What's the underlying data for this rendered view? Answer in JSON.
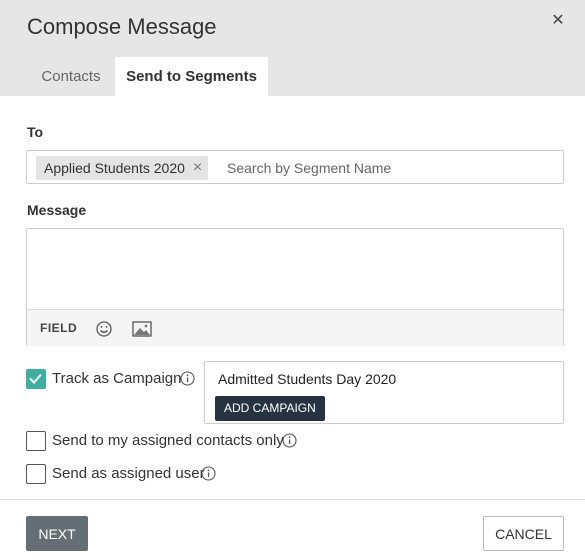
{
  "dialog": {
    "title": "Compose Message",
    "close_icon": "close-icon"
  },
  "tabs": [
    {
      "label": "Contacts",
      "active": false
    },
    {
      "label": "Send to Segments",
      "active": true
    }
  ],
  "to": {
    "label": "To",
    "selected_segments": [
      {
        "label": "Applied Students 2020",
        "remove_icon": "close-icon"
      }
    ],
    "placeholder": "Search by Segment Name",
    "value": ""
  },
  "message": {
    "label": "Message",
    "value": "",
    "toolbar": {
      "field_label": "FIELD",
      "emoji_icon": "smiley-icon",
      "image_icon": "image-icon"
    }
  },
  "options": {
    "track_campaign": {
      "label": "Track as Campaign",
      "checked": true,
      "icon": "info-icon"
    },
    "assigned_only": {
      "label": "Send to my assigned contacts only",
      "checked": false,
      "icon": "info-icon"
    },
    "send_as_user": {
      "label": "Send as assigned user",
      "checked": false,
      "icon": "info-icon"
    }
  },
  "campaign": {
    "name": "Admitted Students Day 2020",
    "add_label": "ADD CAMPAIGN"
  },
  "footer": {
    "next_label": "NEXT",
    "cancel_label": "CANCEL"
  },
  "colors": {
    "header_bg": "#e6e6e6",
    "accent_teal": "#3daea0",
    "dark_button": "#263442",
    "next_button": "#646f75"
  }
}
